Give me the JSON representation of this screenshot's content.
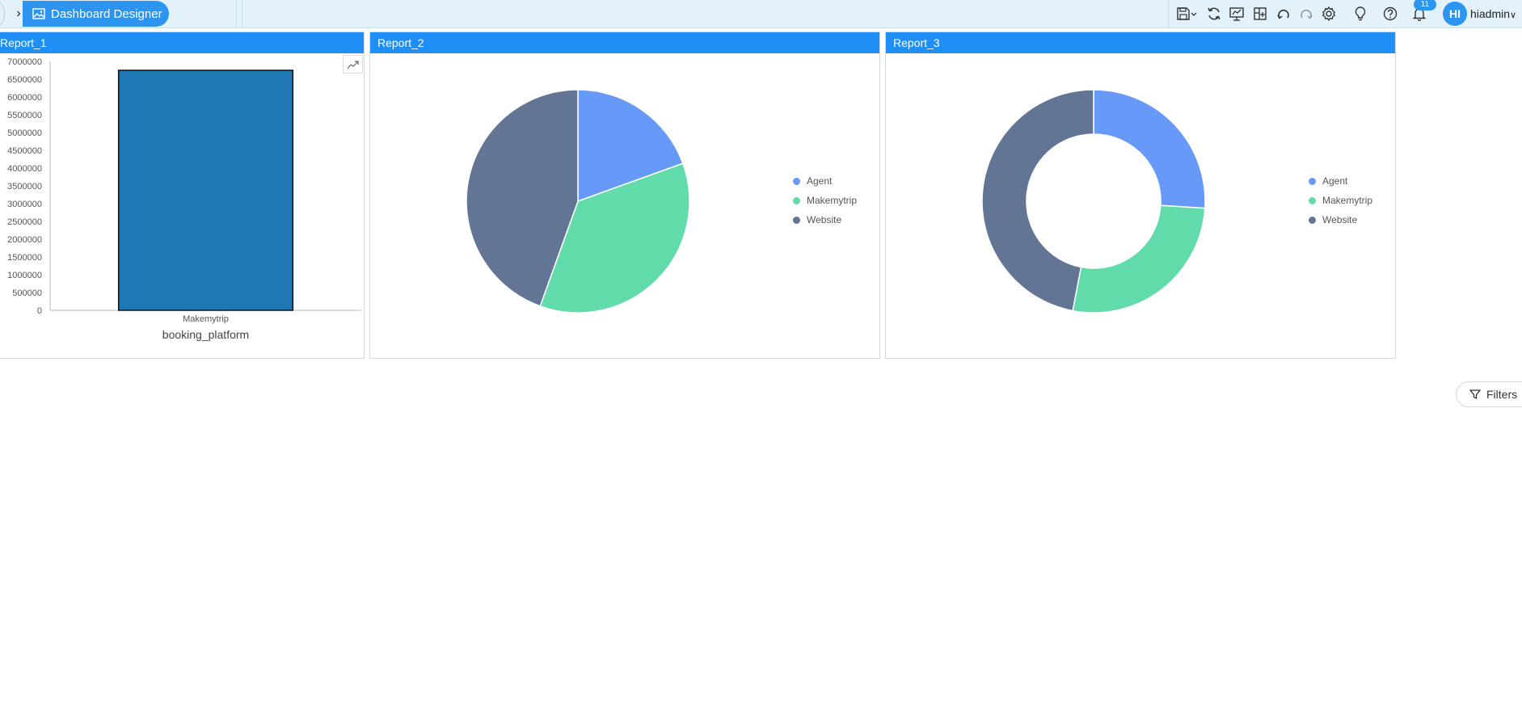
{
  "header": {
    "title": "Dashboard Designer",
    "notification_count": "11",
    "avatar_initials": "HI",
    "username": "hiadmin",
    "toolbar_icons": [
      "save-icon",
      "refresh-icon",
      "presentation-icon",
      "add-panel-icon",
      "undo-icon",
      "redo-icon",
      "settings-icon",
      "lightbulb-icon",
      "help-icon",
      "bell-icon"
    ]
  },
  "reports": [
    {
      "title": "Report_1"
    },
    {
      "title": "Report_2"
    },
    {
      "title": "Report_3"
    }
  ],
  "filters": {
    "label": "Filters"
  },
  "colors": {
    "accent": "#1f8ff5",
    "bar": "#1f77b4",
    "agent": "#6699f8",
    "makemytrip": "#61dba9",
    "website": "#627594"
  },
  "chart_data": [
    {
      "type": "bar",
      "categories": [
        "Makemytrip"
      ],
      "values": [
        6750000
      ],
      "xlabel": "booking_platform",
      "ylabel": "",
      "ylim": [
        0,
        7000000
      ],
      "yticks": [
        "0",
        "500000",
        "1000000",
        "1500000",
        "2000000",
        "2500000",
        "3000000",
        "3500000",
        "4000000",
        "4500000",
        "5000000",
        "5500000",
        "6000000",
        "6500000",
        "7000000"
      ],
      "grid": false
    },
    {
      "type": "pie",
      "labels": [
        "Agent",
        "Makemytrip",
        "Website"
      ],
      "values": [
        19.5,
        36,
        44.5
      ],
      "legend": "right"
    },
    {
      "type": "pie",
      "variant": "donut",
      "labels": [
        "Agent",
        "Makemytrip",
        "Website"
      ],
      "values": [
        26,
        27,
        47
      ],
      "legend": "right"
    }
  ]
}
